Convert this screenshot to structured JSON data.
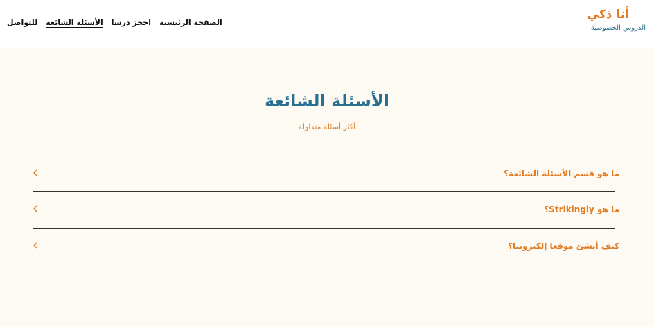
{
  "header": {
    "brand_title": "أنا ذكي",
    "brand_subtitle": "الدروس الخصوصية",
    "nav": [
      {
        "label": "الصفحة الرئيسية",
        "active": false
      },
      {
        "label": "احجز درسا",
        "active": false
      },
      {
        "label": "الأسئلة الشائعة",
        "active": true
      },
      {
        "label": "للتواصل",
        "active": false
      }
    ]
  },
  "main": {
    "title": "الأسئلة الشائعة",
    "subtitle": "أكثر أسئلة متداولة",
    "faqs": [
      {
        "question": "ما هو قسم الأسئلة الشائعة؟",
        "icon": "chevron-left-icon"
      },
      {
        "question": "ما هو Strikingly؟",
        "icon": "chevron-left-icon"
      },
      {
        "question": "كيف أنشئ موقعا إلكترونيا؟",
        "icon": "chevron-left-icon"
      }
    ]
  },
  "colors": {
    "accent": "#e07b22",
    "brand_blue": "#2a6f8f",
    "background": "#fdf9f3",
    "header_bg": "#ffffff"
  }
}
